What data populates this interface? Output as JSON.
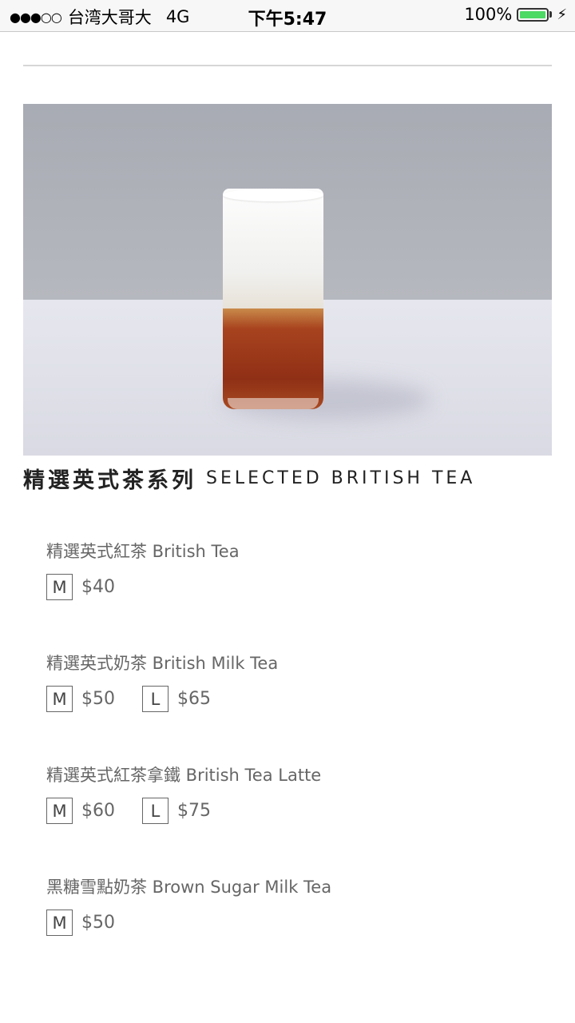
{
  "status_bar": {
    "signal": "●●●○○",
    "carrier": "台湾大哥大",
    "network": "4G",
    "time": "下午5:47",
    "battery_percent": "100%",
    "battery_level": 1.0,
    "battery_color": "#4cd964"
  },
  "section": {
    "title_cn": "精選英式茶系列",
    "title_en": "SELECTED BRITISH TEA"
  },
  "items": [
    {
      "name": "精選英式紅茶 British Tea",
      "prices": [
        {
          "size": "M",
          "price": "$40"
        }
      ]
    },
    {
      "name": "精選英式奶茶 British Milk Tea",
      "prices": [
        {
          "size": "M",
          "price": "$50"
        },
        {
          "size": "L",
          "price": "$65"
        }
      ]
    },
    {
      "name": "精選英式紅茶拿鐵 British Tea Latte",
      "prices": [
        {
          "size": "M",
          "price": "$60"
        },
        {
          "size": "L",
          "price": "$75"
        }
      ]
    },
    {
      "name": "黑糖雪點奶茶 Brown Sugar Milk Tea",
      "prices": [
        {
          "size": "M",
          "price": "$50"
        }
      ]
    }
  ]
}
